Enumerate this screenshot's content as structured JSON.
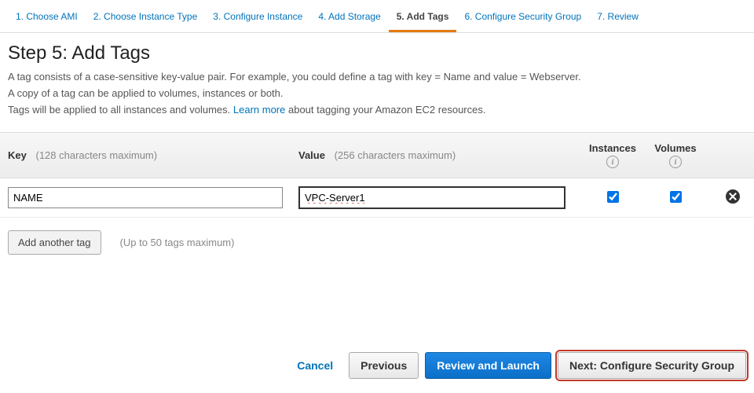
{
  "steps": {
    "s1": "1. Choose AMI",
    "s2": "2. Choose Instance Type",
    "s3": "3. Configure Instance",
    "s4": "4. Add Storage",
    "s5": "5. Add Tags",
    "s6": "6. Configure Security Group",
    "s7": "7. Review"
  },
  "heading": "Step 5: Add Tags",
  "desc": {
    "line1": "A tag consists of a case-sensitive key-value pair. For example, you could define a tag with key = Name and value = Webserver.",
    "line2": "A copy of a tag can be applied to volumes, instances or both.",
    "line3_pre": "Tags will be applied to all instances and volumes. ",
    "learn_more": "Learn more",
    "line3_post": " about tagging your Amazon EC2 resources."
  },
  "table": {
    "key_label": "Key",
    "key_hint": "(128 characters maximum)",
    "value_label": "Value",
    "value_hint": "(256 characters maximum)",
    "instances_label": "Instances",
    "volumes_label": "Volumes"
  },
  "row": {
    "key": "NAME",
    "value": "VPC-Server1",
    "instances_checked": true,
    "volumes_checked": true
  },
  "add": {
    "button": "Add another tag",
    "hint": "(Up to 50 tags maximum)"
  },
  "footer": {
    "cancel": "Cancel",
    "previous": "Previous",
    "review": "Review and Launch",
    "next": "Next: Configure Security Group"
  }
}
